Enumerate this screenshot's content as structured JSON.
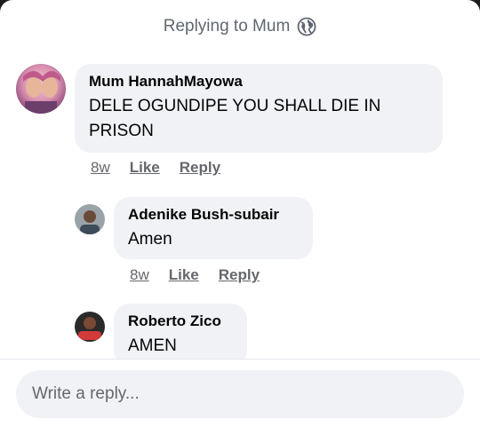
{
  "header": {
    "title": "Replying to Mum",
    "icon": "globe-icon"
  },
  "comments": [
    {
      "author": "Mum HannahMayowa",
      "text": "DELE OGUNDIPE YOU SHALL DIE IN PRISON",
      "time": "8w",
      "like": "Like",
      "reply": "Reply"
    },
    {
      "author": "Adenike Bush-subair",
      "text": "Amen",
      "time": "8w",
      "like": "Like",
      "reply": "Reply"
    },
    {
      "author": "Roberto Zico",
      "text": "AMEN"
    }
  ],
  "composer": {
    "placeholder": "Write a reply..."
  },
  "colors": {
    "bubble": "#f0f2f5",
    "meta_text": "#65676b",
    "text": "#050505"
  }
}
